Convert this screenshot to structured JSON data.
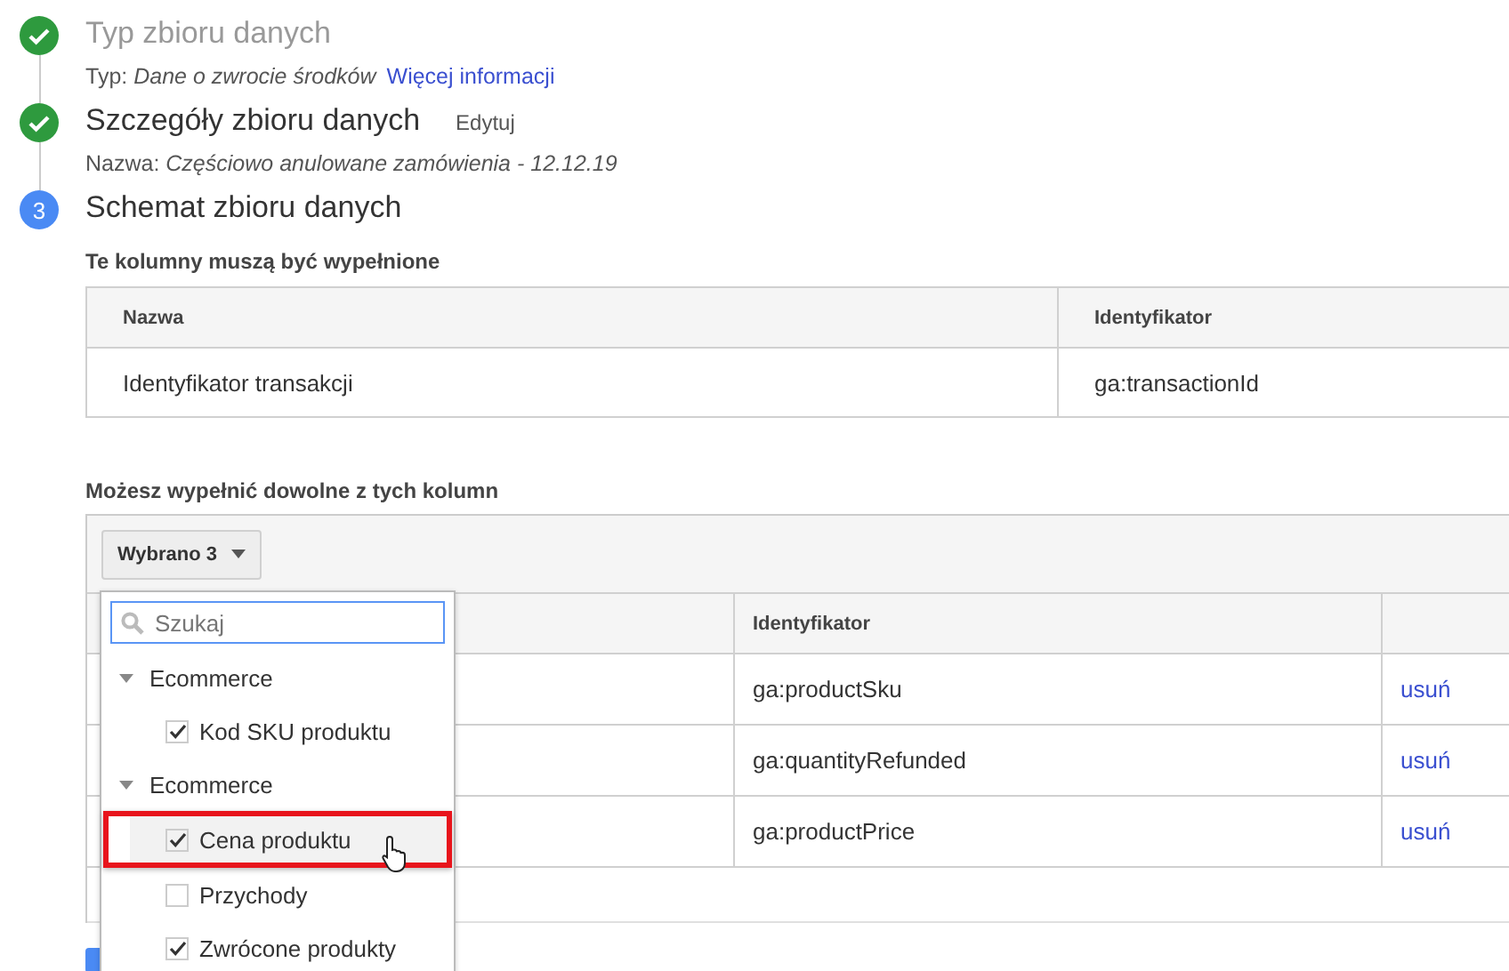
{
  "steps": [
    {
      "kind": "check",
      "dimmed": true,
      "title": "Typ zbioru danych",
      "detail_label": "Typ:",
      "detail_value": "Dane o zwrocie środków",
      "link": "Więcej informacji"
    },
    {
      "kind": "check",
      "dimmed": false,
      "title": "Szczegóły zbioru danych",
      "action": "Edytuj",
      "detail_label": "Nazwa:",
      "detail_value": "Częściowo anulowane zamówienia - 12.12.19"
    },
    {
      "kind": "number",
      "dimmed": false,
      "number": "3",
      "title": "Schemat zbioru danych"
    }
  ],
  "required_columns": {
    "title": "Te kolumny muszą być wypełnione",
    "columns": [
      "Nazwa",
      "Identyfikator"
    ],
    "rows": [
      [
        "Identyfikator transakcji",
        "ga:transactionId"
      ]
    ]
  },
  "optional_columns": {
    "title": "Możesz wypełnić dowolne z tych kolumn",
    "selector_button": "Wybrano 3",
    "column_2": "Identyfikator",
    "rows": [
      {
        "identifier": "ga:productSku",
        "remove_link": "usuń"
      },
      {
        "identifier": "ga:quantityRefunded",
        "remove_link": "usuń"
      },
      {
        "identifier": "ga:productPrice",
        "remove_link": "usuń"
      }
    ]
  },
  "dropdown": {
    "search_placeholder": "Szukaj",
    "groups": [
      {
        "label": "Ecommerce",
        "expanded": true,
        "items": [
          {
            "label": "Kod SKU produktu",
            "checked": true,
            "highlighted": false
          }
        ]
      },
      {
        "label": "Ecommerce",
        "expanded": true,
        "items": [
          {
            "label": "Cena produktu",
            "checked": true,
            "highlighted": true
          },
          {
            "label": "Przychody",
            "checked": false,
            "highlighted": false
          },
          {
            "label": "Zwrócone produkty",
            "checked": true,
            "highlighted": false
          }
        ]
      }
    ]
  }
}
